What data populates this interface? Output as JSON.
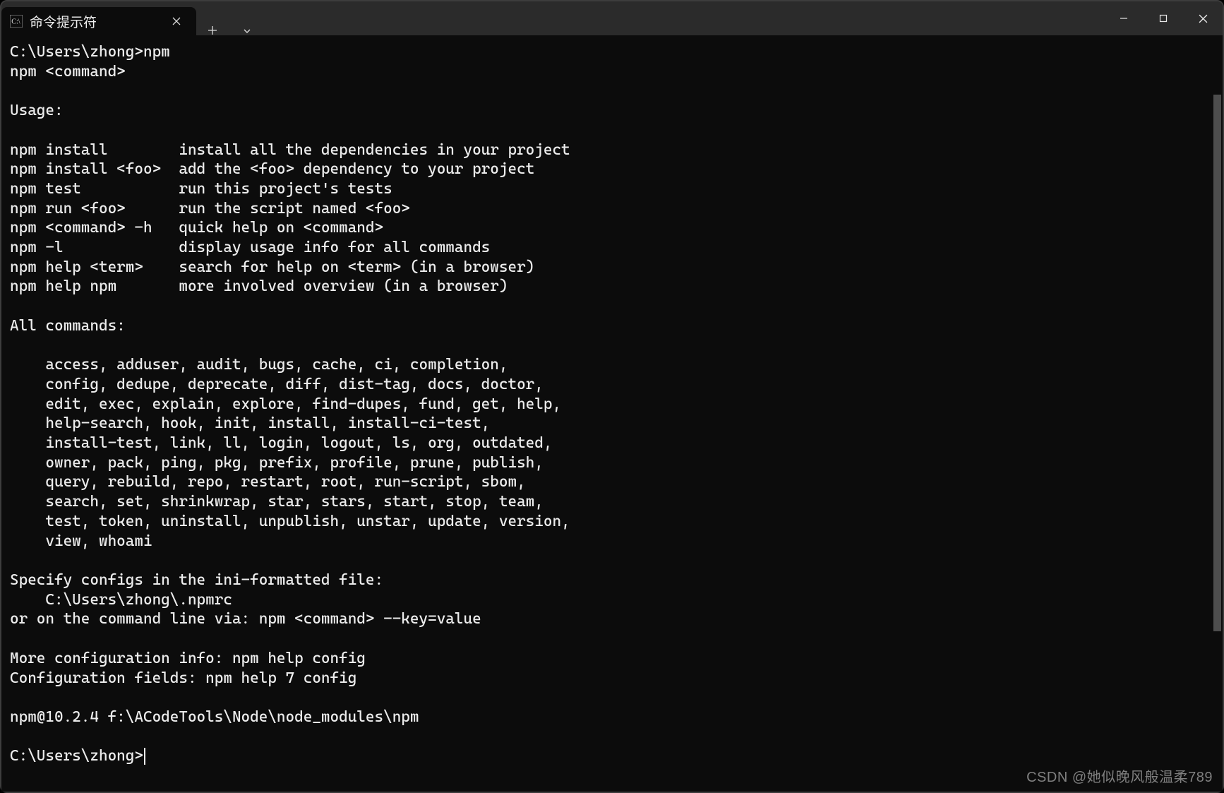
{
  "titlebar": {
    "tab_title": "命令提示符"
  },
  "terminal": {
    "lines": [
      "C:\\Users\\zhong>npm",
      "npm <command>",
      "",
      "Usage:",
      "",
      "npm install        install all the dependencies in your project",
      "npm install <foo>  add the <foo> dependency to your project",
      "npm test           run this project's tests",
      "npm run <foo>      run the script named <foo>",
      "npm <command> -h   quick help on <command>",
      "npm -l             display usage info for all commands",
      "npm help <term>    search for help on <term> (in a browser)",
      "npm help npm       more involved overview (in a browser)",
      "",
      "All commands:",
      "",
      "    access, adduser, audit, bugs, cache, ci, completion,",
      "    config, dedupe, deprecate, diff, dist-tag, docs, doctor,",
      "    edit, exec, explain, explore, find-dupes, fund, get, help,",
      "    help-search, hook, init, install, install-ci-test,",
      "    install-test, link, ll, login, logout, ls, org, outdated,",
      "    owner, pack, ping, pkg, prefix, profile, prune, publish,",
      "    query, rebuild, repo, restart, root, run-script, sbom,",
      "    search, set, shrinkwrap, star, stars, start, stop, team,",
      "    test, token, uninstall, unpublish, unstar, update, version,",
      "    view, whoami",
      "",
      "Specify configs in the ini-formatted file:",
      "    C:\\Users\\zhong\\.npmrc",
      "or on the command line via: npm <command> --key=value",
      "",
      "More configuration info: npm help config",
      "Configuration fields: npm help 7 config",
      "",
      "npm@10.2.4 f:\\ACodeTools\\Node\\node_modules\\npm",
      ""
    ],
    "prompt": "C:\\Users\\zhong>"
  },
  "watermark": "CSDN @她似晚风般温柔789"
}
